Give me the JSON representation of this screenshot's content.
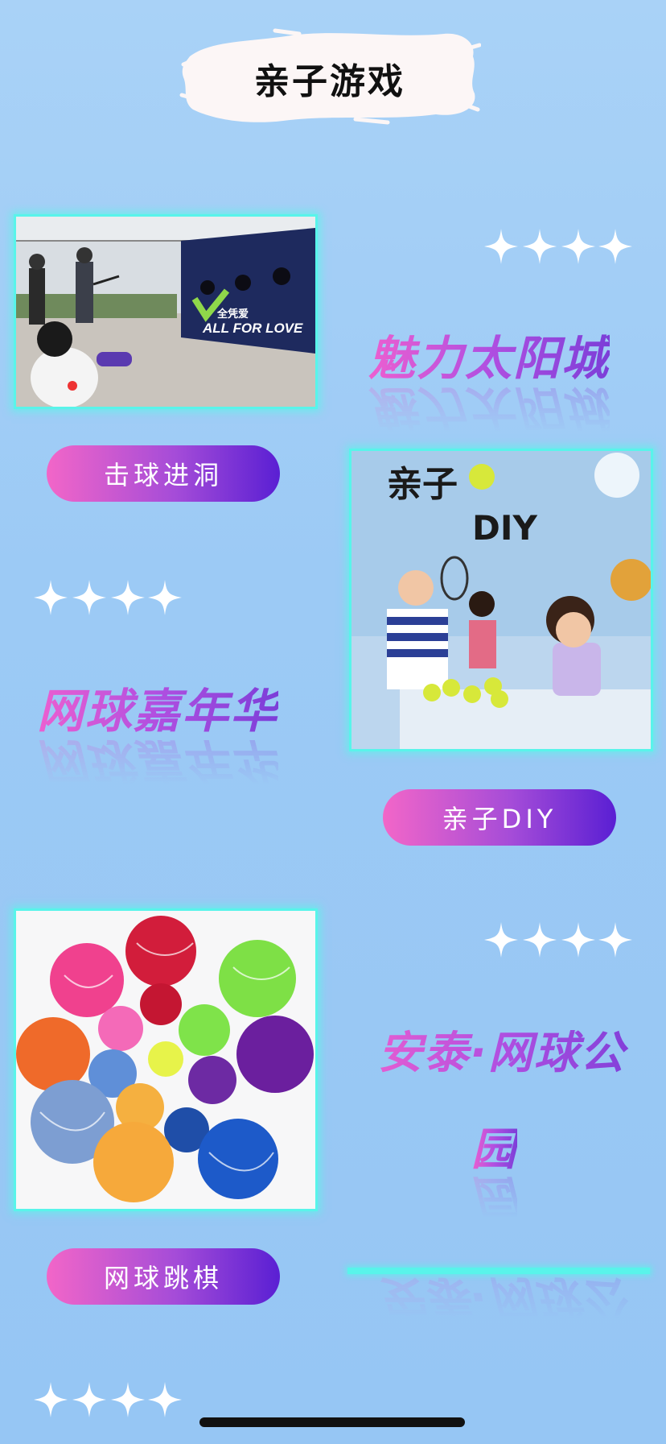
{
  "header": {
    "title": "亲子游戏"
  },
  "activities": [
    {
      "label": "击球进洞"
    },
    {
      "label": "亲子DIY"
    },
    {
      "label": "网球跳棋"
    }
  ],
  "headlines": {
    "h1": "魅力太阳城",
    "h2": "网球嘉年华",
    "h3_line1": "安泰·网球公",
    "h3_line2": "园"
  },
  "photo1_sign": {
    "line1": "ALL FOR LOVE",
    "line2": "全凭爱"
  },
  "photo2_sign": {
    "line1": "亲子",
    "line2": "DIY"
  },
  "colors": {
    "background": "#9ccaf5",
    "accent_cyan": "#59f4ea",
    "pill_start": "#f266c8",
    "pill_end": "#5a1fd3",
    "text_gradient_start": "#ec5fd0",
    "text_gradient_end": "#7c3ed8"
  },
  "icons": {
    "star_rows": [
      "four-sparkle-stars-icon",
      "four-sparkle-stars-icon",
      "four-sparkle-stars-icon",
      "four-sparkle-stars-icon"
    ]
  }
}
